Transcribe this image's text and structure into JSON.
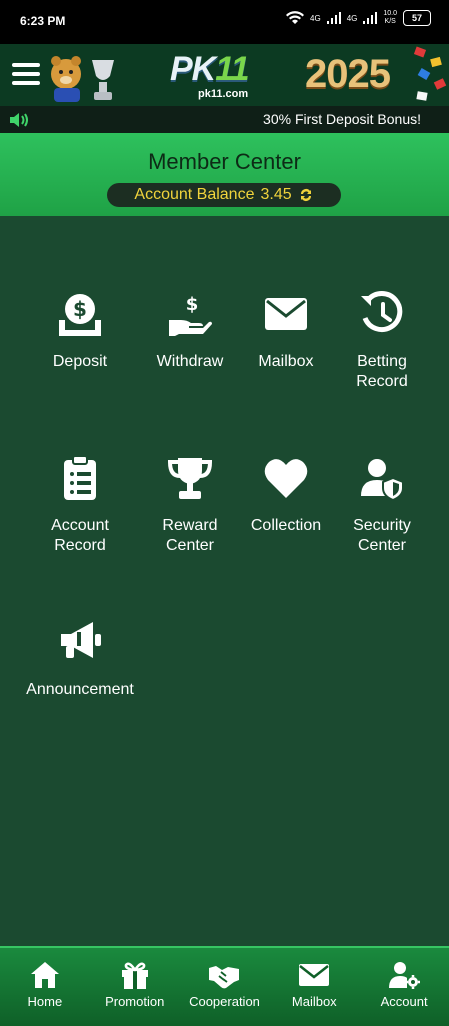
{
  "status": {
    "time": "6:23 PM",
    "network_1": "4G",
    "network_2": "4G",
    "speed_value": "10.0",
    "speed_unit": "K/S",
    "battery": "57"
  },
  "header": {
    "logo_main": "PK",
    "logo_number": "11",
    "logo_sub": "pk11.com",
    "year": "2025"
  },
  "marquee": {
    "text": "30% First Deposit Bonus!"
  },
  "member": {
    "title": "Member Center",
    "balance_label": "Account Balance",
    "balance_value": "3.45"
  },
  "grid": {
    "deposit": "Deposit",
    "withdraw": "Withdraw",
    "mailbox": "Mailbox",
    "betting_record": "Betting\nRecord",
    "account_record": "Account\nRecord",
    "reward_center": "Reward\nCenter",
    "collection": "Collection",
    "security_center": "Security\nCenter",
    "announcement": "Announcement"
  },
  "nav": {
    "home": "Home",
    "promotion": "Promotion",
    "cooperation": "Cooperation",
    "mailbox": "Mailbox",
    "account": "Account"
  },
  "colors": {
    "header_green": "#2ec15d",
    "main_bg": "#1b4a30",
    "balance_text": "#f0d33c"
  }
}
